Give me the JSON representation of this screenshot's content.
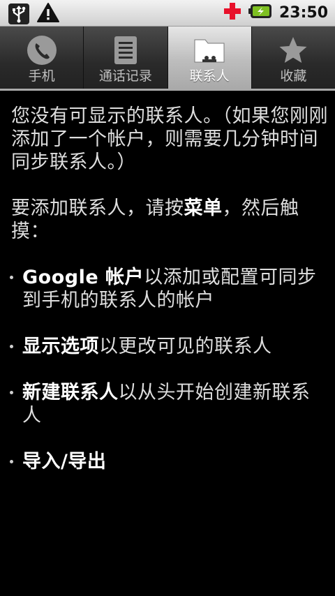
{
  "status_bar": {
    "time": "23:50",
    "icons": [
      "usb-icon",
      "warning-icon",
      "plus-red-icon",
      "battery-charging-icon"
    ]
  },
  "tabs": [
    {
      "label": "手机",
      "icon": "phone-icon",
      "selected": false
    },
    {
      "label": "通话记录",
      "icon": "call-log-icon",
      "selected": false
    },
    {
      "label": "联系人",
      "icon": "contacts-icon",
      "selected": true
    },
    {
      "label": "收藏",
      "icon": "star-icon",
      "selected": false
    }
  ],
  "content": {
    "no_contacts": "您没有可显示的联系人。（如果您刚刚添加了一个帐户，则需要几分钟时间同步联系人。）",
    "add_intro_pre": "要添加联系人，请按",
    "add_intro_menu": "菜单",
    "add_intro_post": "，然后触摸：",
    "bullets": [
      {
        "strong": "Google 帐户",
        "rest": "以添加或配置可同步到手机的联系人的帐户"
      },
      {
        "strong": "显示选项",
        "rest": "以更改可见的联系人"
      },
      {
        "strong": "新建联系人",
        "rest": "以从头开始创建新联系人"
      },
      {
        "strong": "导入/导出",
        "rest": ""
      }
    ]
  }
}
